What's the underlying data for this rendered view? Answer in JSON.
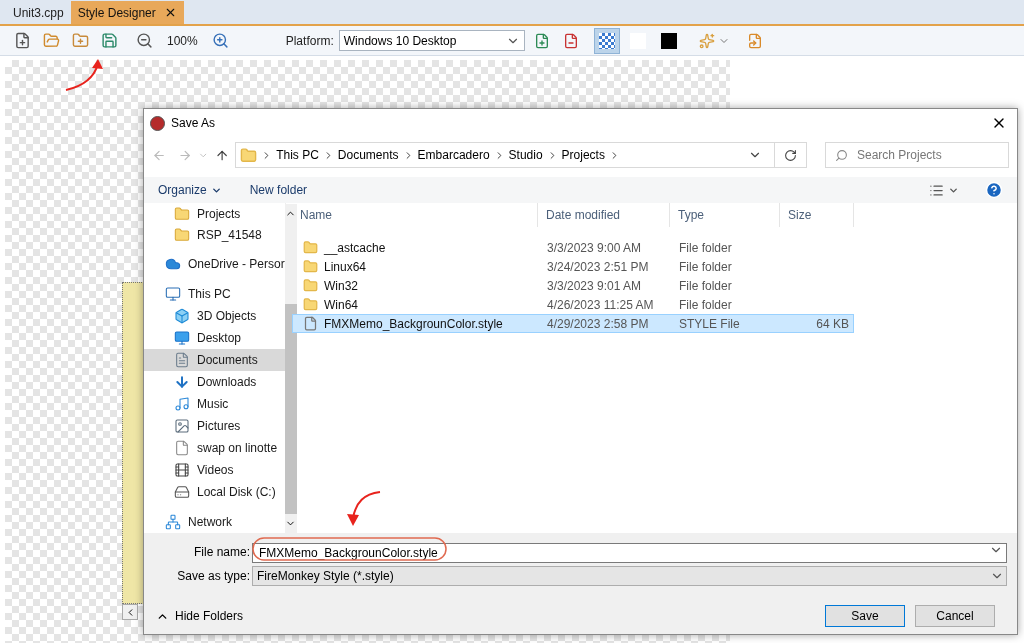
{
  "tabs": [
    {
      "label": "Unit3.cpp",
      "selected": false,
      "closable": false
    },
    {
      "label": "Style Designer",
      "selected": true,
      "closable": true
    }
  ],
  "toolbar": {
    "zoom": "100%",
    "platform_label": "Platform:",
    "platform": "Windows 10 Desktop",
    "backgrounds": [
      {
        "kind": "checker",
        "selected": true
      },
      {
        "kind": "white",
        "selected": false
      },
      {
        "kind": "black",
        "selected": false
      }
    ]
  },
  "dialog": {
    "title": "Save As",
    "breadcrumb": [
      "This PC",
      "Documents",
      "Embarcadero",
      "Studio",
      "Projects"
    ],
    "search": {
      "placeholder": "Search Projects"
    },
    "organize": "Organize",
    "new_folder": "New folder",
    "nav": {
      "scrolled_children": [
        {
          "label": "Projects",
          "kind": "folder",
          "selected": false
        },
        {
          "label": "RSP_41548",
          "kind": "folder",
          "selected": false
        }
      ],
      "items": [
        {
          "label": "OneDrive - Persor",
          "kind": "cloud",
          "selected": false
        },
        {
          "label": "This PC",
          "kind": "pc",
          "selected": false,
          "children": [
            {
              "label": "3D Objects",
              "kind": "cube",
              "selected": false
            },
            {
              "label": "Desktop",
              "kind": "desktop",
              "selected": false
            },
            {
              "label": "Documents",
              "kind": "document",
              "selected": true
            },
            {
              "label": "Downloads",
              "kind": "download",
              "selected": false
            },
            {
              "label": "Music",
              "kind": "music",
              "selected": false
            },
            {
              "label": "Pictures",
              "kind": "pictures",
              "selected": false
            },
            {
              "label": "swap on linotte",
              "kind": "file",
              "selected": false
            },
            {
              "label": "Videos",
              "kind": "video",
              "selected": false
            },
            {
              "label": "Local Disk (C:)",
              "kind": "disk",
              "selected": false
            }
          ]
        },
        {
          "label": "Network",
          "kind": "network",
          "selected": false
        }
      ]
    },
    "files": {
      "columns": [
        "Name",
        "Date modified",
        "Type",
        "Size"
      ],
      "rows": [
        {
          "kind": "folder",
          "name": "__astcache",
          "date": "3/3/2023 9:00 AM",
          "type": "File folder",
          "selected": false
        },
        {
          "kind": "folder",
          "name": "Linux64",
          "date": "3/24/2023 2:51 PM",
          "type": "File folder",
          "selected": false
        },
        {
          "kind": "folder",
          "name": "Win32",
          "date": "3/3/2023 9:01 AM",
          "type": "File folder",
          "selected": false
        },
        {
          "kind": "folder",
          "name": "Win64",
          "date": "4/26/2023 11:25 AM",
          "type": "File folder",
          "selected": false
        },
        {
          "kind": "file",
          "name": "FMXMemo_BackgrounColor.style",
          "date": "4/29/2023 2:58 PM",
          "type": "STYLE File",
          "size": "64 KB",
          "selected": true
        }
      ]
    },
    "file_name": {
      "label": "File name:",
      "value": "FMXMemo_BackgrounColor.style"
    },
    "save_type": {
      "label": "Save as type:",
      "value": "FireMonkey Style (*.style)"
    },
    "hide_folders": "Hide Folders",
    "buttons": [
      {
        "label": "Save",
        "default": true
      },
      {
        "label": "Cancel",
        "default": false
      }
    ]
  }
}
